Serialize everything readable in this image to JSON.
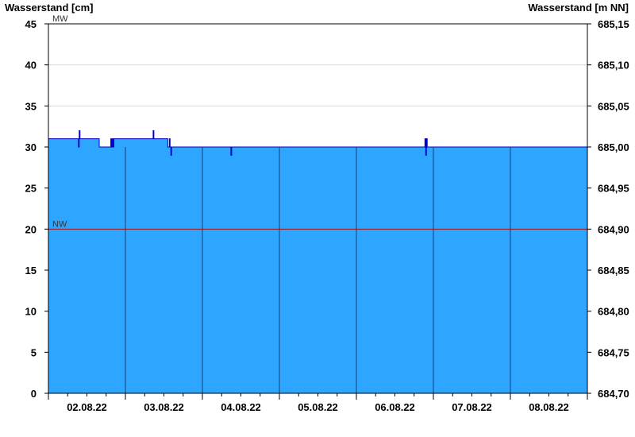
{
  "chart_data": {
    "type": "area",
    "ylabel_left": "Wasserstand [cm]",
    "ylabel_right": "Wasserstand [m NN]",
    "ylim": [
      0,
      45
    ],
    "ylim_right": [
      684.7,
      685.15
    ],
    "yticks_left": [
      "0",
      "5",
      "10",
      "15",
      "20",
      "25",
      "30",
      "35",
      "40",
      "45"
    ],
    "yticks_right": [
      "684,70",
      "684,75",
      "684,80",
      "684,85",
      "684,90",
      "684,95",
      "685,00",
      "685,05",
      "685,10",
      "685,15"
    ],
    "x_range_days": [
      1.5,
      8.5
    ],
    "x_unit": "day of August 2022",
    "xtick_labels": [
      {
        "day": 2,
        "label": "02.08.22"
      },
      {
        "day": 3,
        "label": "03.08.22"
      },
      {
        "day": 4,
        "label": "04.08.22"
      },
      {
        "day": 5,
        "label": "05.08.22"
      },
      {
        "day": 6,
        "label": "06.08.22"
      },
      {
        "day": 7,
        "label": "07.08.22"
      },
      {
        "day": 8,
        "label": "08.08.22"
      }
    ],
    "reference_lines": [
      {
        "name": "MW",
        "value": 45,
        "color": "#006400"
      },
      {
        "name": "NW",
        "value": 20,
        "color": "#a01010"
      }
    ],
    "series": [
      {
        "x": [
          1.5,
          1.88,
          1.89,
          1.9,
          1.91,
          2.15,
          2.16,
          2.3,
          2.31,
          2.32,
          2.33,
          2.34,
          2.35,
          2.36,
          2.85,
          2.86,
          2.87,
          3.04,
          3.05,
          3.06,
          3.07,
          3.08,
          3.09,
          3.1,
          3.11,
          3.12,
          3.13,
          3.86,
          3.87,
          3.88,
          6.38,
          6.39,
          6.4,
          6.41,
          6.42,
          8.5
        ],
        "values": [
          31,
          31,
          30,
          32,
          31,
          31,
          30,
          30,
          31,
          30,
          31,
          30,
          31,
          31,
          31,
          32,
          31,
          31,
          30,
          30,
          31,
          30,
          29,
          30,
          30,
          30,
          30,
          30,
          29,
          30,
          30,
          31,
          29,
          31,
          30,
          30
        ]
      }
    ],
    "colors": {
      "fill": "#2ea6ff",
      "line": "#0000c8",
      "day_lines": "#1a3d7a",
      "grid": "#d8d8d8"
    }
  }
}
